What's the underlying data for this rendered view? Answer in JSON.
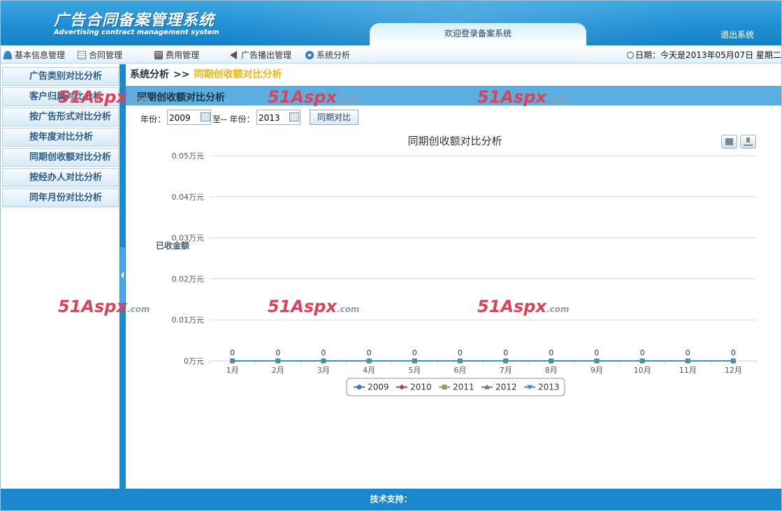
{
  "header": {
    "title_cn": "广告合同备案管理系统",
    "title_en": "Advertising contract management system",
    "welcome": "欢迎登录备案系统",
    "logout": "退出系统"
  },
  "topnav": {
    "items": [
      {
        "label": "基本信息管理",
        "icon": "user-icon"
      },
      {
        "label": "合同管理",
        "icon": "document-icon"
      },
      {
        "label": "费用管理",
        "icon": "money-icon"
      },
      {
        "label": "广告播出管理",
        "icon": "speaker-icon"
      },
      {
        "label": "系统分析",
        "icon": "gear-icon"
      }
    ],
    "date": "日期：今天是2013年05月07日 星期二"
  },
  "sidebar": {
    "items": [
      {
        "label": "广告类别对比分析"
      },
      {
        "label": "客户归属对比分析"
      },
      {
        "label": "按广告形式对比分析"
      },
      {
        "label": "按年度对比分析"
      },
      {
        "label": "同期创收额对比分析"
      },
      {
        "label": "按经办人对比分析"
      },
      {
        "label": "同年月份对比分析"
      }
    ]
  },
  "breadcrumb": {
    "parent": "系统分析",
    "sep": ">>",
    "current": "同期创收额对比分析"
  },
  "section": {
    "title": "同期创收额对比分析"
  },
  "form": {
    "from_label": "年份：",
    "from_value": "2009",
    "to_label": "至-- 年份：",
    "to_value": "2013",
    "button": "同期对比"
  },
  "watermark": {
    "big": "51Aspx",
    "small": ".com"
  },
  "chart_data": {
    "type": "line",
    "title": "同期创收额对比分析",
    "ylabel": "已收金额",
    "yunit": "万元",
    "ylim": [
      0,
      0.05
    ],
    "yticks": [
      "0万元",
      "0.01万元",
      "0.02万元",
      "0.03万元",
      "0.04万元",
      "0.05万元"
    ],
    "categories": [
      "1月",
      "2月",
      "3月",
      "4月",
      "5月",
      "6月",
      "7月",
      "8月",
      "9月",
      "10月",
      "11月",
      "12月"
    ],
    "grid": true,
    "legend": "bottom",
    "series": [
      {
        "name": "2009",
        "color": "#4572a7",
        "marker": "circle",
        "values": [
          0,
          0,
          0,
          0,
          0,
          0,
          0,
          0,
          0,
          0,
          0,
          0
        ]
      },
      {
        "name": "2010",
        "color": "#aa4643",
        "marker": "diamond",
        "values": [
          0,
          0,
          0,
          0,
          0,
          0,
          0,
          0,
          0,
          0,
          0,
          0
        ]
      },
      {
        "name": "2011",
        "color": "#89a54e",
        "marker": "square",
        "values": [
          0,
          0,
          0,
          0,
          0,
          0,
          0,
          0,
          0,
          0,
          0,
          0
        ]
      },
      {
        "name": "2012",
        "color": "#80699b",
        "marker": "triangle",
        "values": [
          0,
          0,
          0,
          0,
          0,
          0,
          0,
          0,
          0,
          0,
          0,
          0
        ]
      },
      {
        "name": "2013",
        "color": "#3d96ae",
        "marker": "triangle-down",
        "values": [
          0,
          0,
          0,
          0,
          0,
          0,
          0,
          0,
          0,
          0,
          0,
          0
        ]
      }
    ],
    "data_labels": true
  },
  "footer": {
    "text": "技术支持："
  }
}
